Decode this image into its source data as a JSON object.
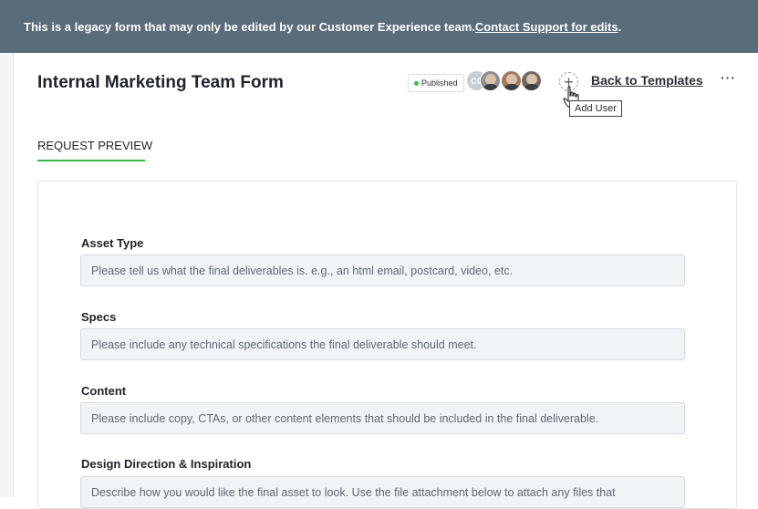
{
  "banner": {
    "text": "This is a legacy form that may only be edited by our Customer Experience team. ",
    "link": "Contact Support for edits",
    "suffix": "."
  },
  "header": {
    "title": "Internal Marketing Team Form",
    "status_badge": "Published",
    "avatars": [
      "CC",
      "user-avatar-2",
      "user-avatar-3",
      "user-avatar-4"
    ],
    "add_user_icon": "+",
    "tooltip": "Add User",
    "back_link": "Back to Templates",
    "more_menu": "···"
  },
  "tabs": {
    "active": "REQUEST PREVIEW"
  },
  "form": {
    "fields": [
      {
        "label": "Asset Type",
        "placeholder": "Please tell us what the final deliverables is. e.g., an html email, postcard, video, etc."
      },
      {
        "label": "Specs",
        "placeholder": "Please include any technical specifications the final deliverable should meet."
      },
      {
        "label": "Content",
        "placeholder": "Please include copy, CTAs, or other content elements that should be included in the final deliverable."
      },
      {
        "label": "Design Direction & Inspiration",
        "placeholder": "Describe how you would like the final asset to look. Use the file attachment below to attach any files that"
      }
    ]
  },
  "colors": {
    "banner_bg": "#5a6b7a",
    "accent_green": "#33b84a",
    "published_dot": "#31c24a"
  }
}
